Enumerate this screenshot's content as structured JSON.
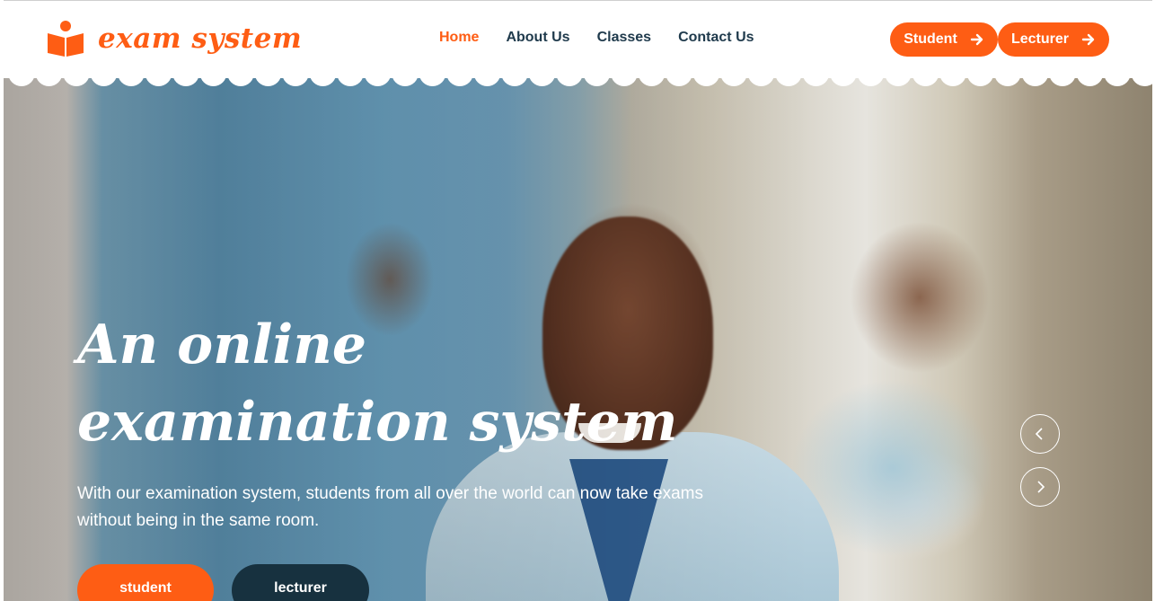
{
  "brand": {
    "name": "exam system",
    "accent_color": "#fe5d14",
    "dark_color": "#17313f",
    "logo_icon": "book-reader-icon"
  },
  "nav": {
    "items": [
      {
        "label": "Home",
        "active": true
      },
      {
        "label": "About Us",
        "active": false
      },
      {
        "label": "Classes",
        "active": false
      },
      {
        "label": "Contact Us",
        "active": false
      }
    ]
  },
  "header_buttons": {
    "student_label": "Student",
    "lecturer_label": "Lecturer",
    "icon": "arrow-right-icon"
  },
  "hero": {
    "title": "An online examination system",
    "description": "With our examination system, students from all over the world can now take exams without being in the same room.",
    "student_button": "student",
    "lecturer_button": "lecturer",
    "prev_icon": "chevron-left-icon",
    "next_icon": "chevron-right-icon"
  }
}
